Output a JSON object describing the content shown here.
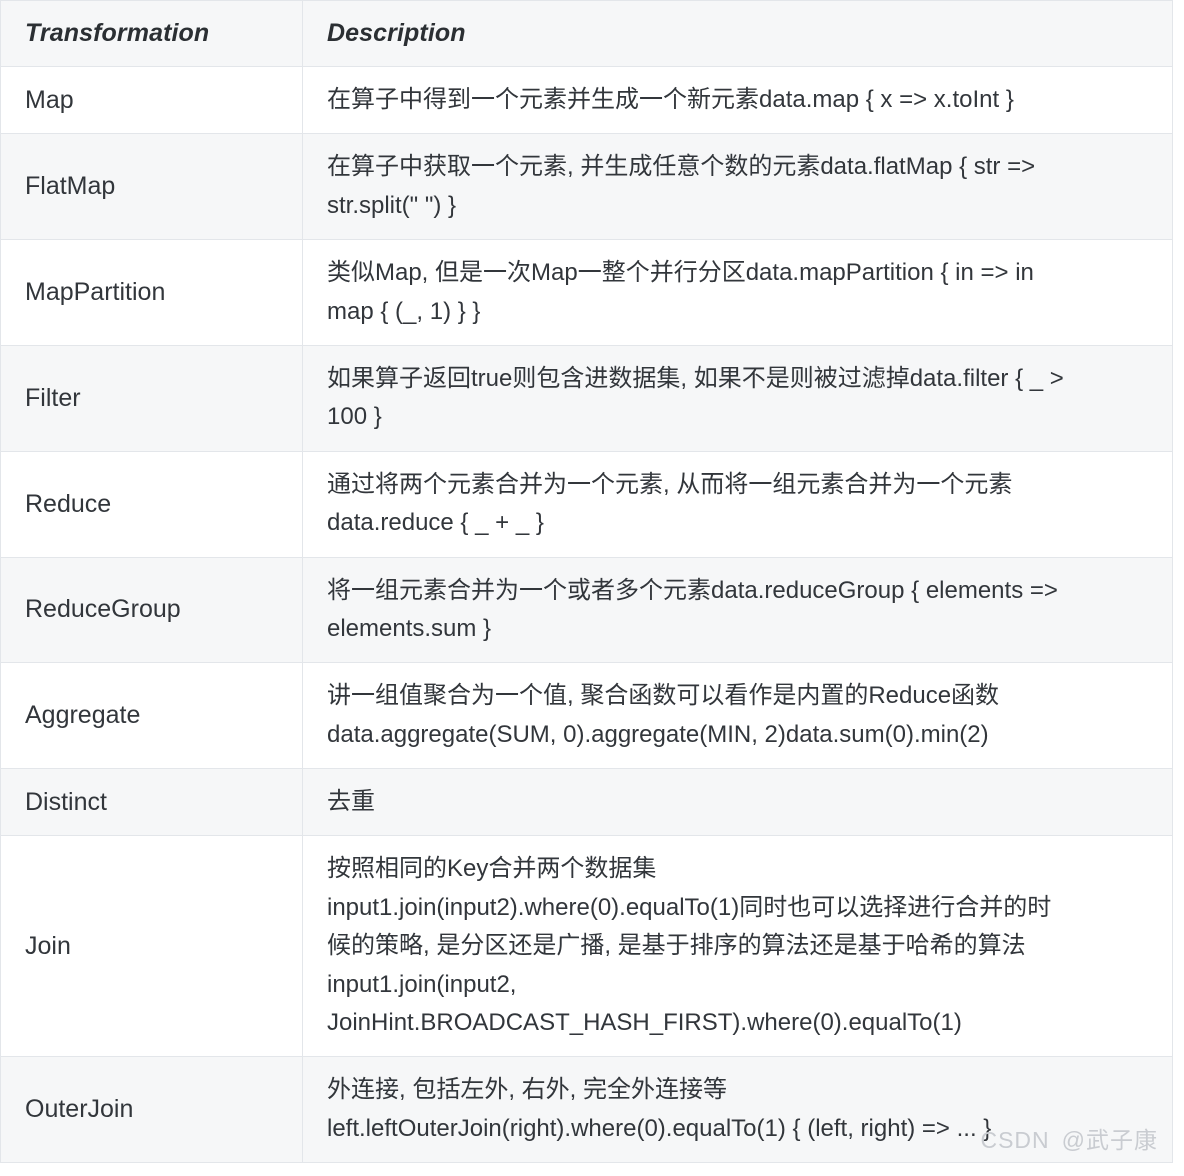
{
  "table": {
    "columns": [
      {
        "key": "transformation",
        "label": "Transformation"
      },
      {
        "key": "description",
        "label": "Description"
      }
    ],
    "rows": [
      {
        "transformation": "Map",
        "description_lines": [
          "在算子中得到一个元素并生成一个新元素data.map { x => x.toInt }"
        ]
      },
      {
        "transformation": "FlatMap",
        "description_lines": [
          "在算子中获取一个元素, 并生成任意个数的元素data.flatMap { str =>",
          "str.split(\" \") }"
        ]
      },
      {
        "transformation": "MapPartition",
        "description_lines": [
          "类似Map, 但是一次Map一整个并行分区data.mapPartition { in => in",
          "map { (_, 1) } }"
        ]
      },
      {
        "transformation": "Filter",
        "description_lines": [
          "如果算子返回true则包含进数据集, 如果不是则被过滤掉data.filter { _ >",
          "100 }"
        ]
      },
      {
        "transformation": "Reduce",
        "description_lines": [
          "通过将两个元素合并为一个元素, 从而将一组元素合并为一个元素",
          "data.reduce { _ + _ }"
        ]
      },
      {
        "transformation": "ReduceGroup",
        "description_lines": [
          "将一组元素合并为一个或者多个元素data.reduceGroup { elements =>",
          "elements.sum }"
        ]
      },
      {
        "transformation": "Aggregate",
        "description_lines": [
          "讲一组值聚合为一个值, 聚合函数可以看作是内置的Reduce函数",
          "data.aggregate(SUM, 0).aggregate(MIN, 2)data.sum(0).min(2)"
        ]
      },
      {
        "transformation": "Distinct",
        "description_lines": [
          "去重"
        ]
      },
      {
        "transformation": "Join",
        "description_lines": [
          "按照相同的Key合并两个数据集",
          "input1.join(input2).where(0).equalTo(1)同时也可以选择进行合并的时",
          "候的策略, 是分区还是广播, 是基于排序的算法还是基于哈希的算法",
          "input1.join(input2,",
          "JoinHint.BROADCAST_HASH_FIRST).where(0).equalTo(1)"
        ]
      },
      {
        "transformation": "OuterJoin",
        "description_lines": [
          "外连接, 包括左外, 右外, 完全外连接等",
          "left.leftOuterJoin(right).where(0).equalTo(1) { (left, right) => ... }"
        ]
      }
    ]
  },
  "watermark": {
    "site": "CSDN",
    "author": "@武子康"
  },
  "colors": {
    "header_bg": "#f6f7f8",
    "row_alt_bg": "#f6f7f8",
    "row_bg": "#ffffff",
    "border": "#e3e6ea",
    "text": "#2d3135",
    "watermark": "#c9ccd1"
  }
}
